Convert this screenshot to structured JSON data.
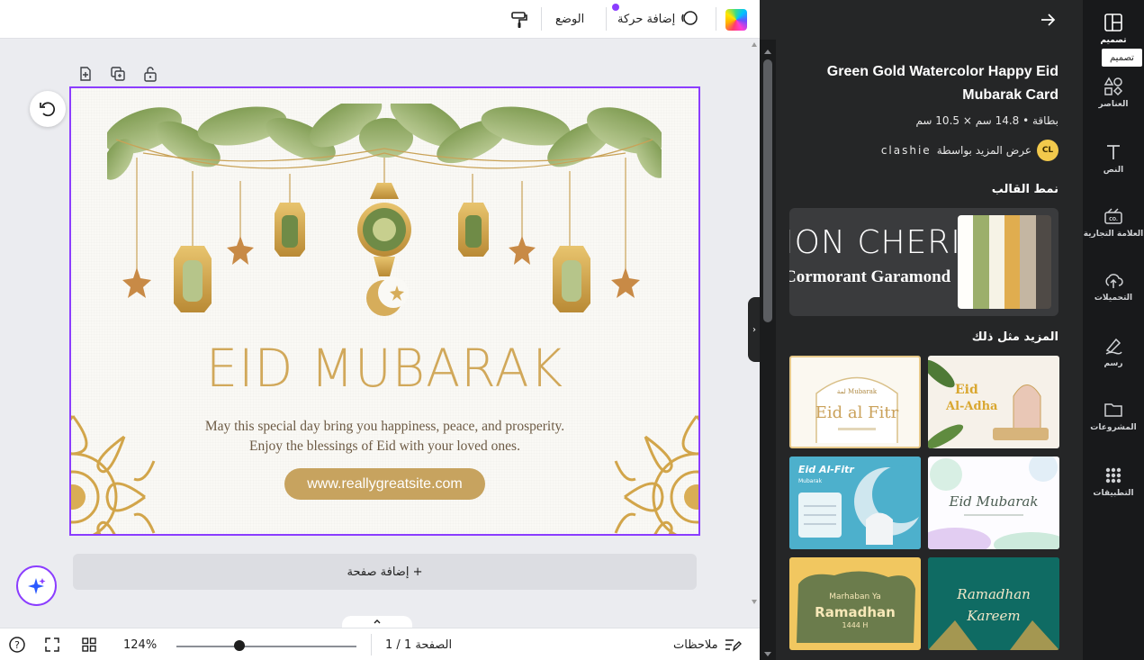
{
  "topbar": {
    "position_label": "الوضع",
    "animate_label": "إضافة حركة"
  },
  "design": {
    "headline": "EID MUBARAK",
    "message": "May this special day bring you happiness, peace, and prosperity. Enjoy the blessings of Eid with your loved ones.",
    "website": "www.reallygreatsite.com"
  },
  "canvas": {
    "add_page_label": "+ إضافة صفحة"
  },
  "bottombar": {
    "notes_label": "ملاحظات",
    "page_indicator": "الصفحة 1 / 1",
    "zoom_label": "124%",
    "zoom_fraction": 0.35
  },
  "panel": {
    "title": "Green Gold Watercolor Happy Eid Mubarak Card",
    "meta": "بطاقة • 14.8 سم × 10.5 سم",
    "author_prefix": "عرض المزيد بواسطة",
    "author_name": "clashie",
    "author_initials": "CL",
    "style_heading": "نمط القالب",
    "style_font_primary": "ION CHERI",
    "style_font_secondary": "Cormorant Garamond",
    "palette": [
      "#fffefa",
      "#9caf6b",
      "#f6f3e6",
      "#e0ad4f",
      "#c4b6a2",
      "#4f4a46"
    ],
    "more_heading": "المزيد مثل ذلك",
    "thumbnails": [
      {
        "line1": "Eid al Fitr",
        "line2": "لمة Mubarak"
      },
      {
        "line1": "Eid",
        "line2": "Al-Adha"
      },
      {
        "line1": "Eid Al-Fitr",
        "line2": "Mubarak"
      },
      {
        "line1": "Eid Mubarak",
        "line2": ""
      },
      {
        "line1": "Marhaban Ya",
        "line2": "Ramadhan",
        "line3": "1444 H"
      },
      {
        "line1": "Ramadhan",
        "line2": "Kareem"
      }
    ]
  },
  "rail": {
    "items": [
      {
        "label": "تصميم"
      },
      {
        "label": "العناصر"
      },
      {
        "label": "النص"
      },
      {
        "label": "العلامة التجارية"
      },
      {
        "label": "التحميلات"
      },
      {
        "label": "رسم"
      },
      {
        "label": "المشروعات"
      },
      {
        "label": "التطبيقات"
      }
    ],
    "tooltip": "تصميم"
  },
  "colors": {
    "accent": "#8b3dff",
    "gold": "#d1a85a",
    "panel_bg": "#252627",
    "rail_bg": "#18191b"
  }
}
